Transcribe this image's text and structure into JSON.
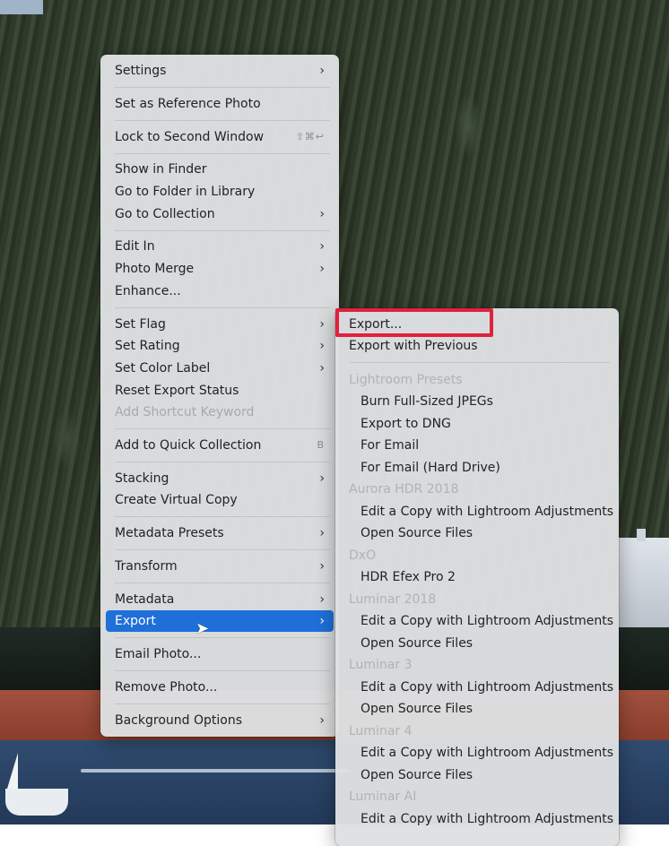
{
  "main_menu": {
    "items": [
      {
        "label": "Settings",
        "arrow": "›"
      },
      {
        "label": "Set as Reference Photo"
      },
      {
        "label": "Lock to Second Window",
        "shortcut": "⇧⌘↩"
      },
      {
        "label": "Show in Finder"
      },
      {
        "label": "Go to Folder in Library"
      },
      {
        "label": "Go to Collection",
        "arrow": "›"
      },
      {
        "label": "Edit In",
        "arrow": "›"
      },
      {
        "label": "Photo Merge",
        "arrow": "›"
      },
      {
        "label": "Enhance..."
      },
      {
        "label": "Set Flag",
        "arrow": "›"
      },
      {
        "label": "Set Rating",
        "arrow": "›"
      },
      {
        "label": "Set Color Label",
        "arrow": "›"
      },
      {
        "label": "Reset Export Status"
      },
      {
        "label": "Add Shortcut Keyword",
        "disabled": true
      },
      {
        "label": "Add to Quick Collection",
        "shortcut": "B"
      },
      {
        "label": "Stacking",
        "arrow": "›"
      },
      {
        "label": "Create Virtual Copy"
      },
      {
        "label": "Metadata Presets",
        "arrow": "›"
      },
      {
        "label": "Transform",
        "arrow": "›"
      },
      {
        "label": "Metadata",
        "arrow": "›"
      },
      {
        "label": "Export",
        "arrow": "›",
        "highlighted": true
      },
      {
        "label": "Email Photo..."
      },
      {
        "label": "Remove Photo..."
      },
      {
        "label": "Background Options",
        "arrow": "›"
      }
    ]
  },
  "export_menu": {
    "items": [
      {
        "label": "Export..."
      },
      {
        "label": "Export with Previous"
      },
      {
        "label": "Lightroom Presets",
        "heading": true
      },
      {
        "label": "Burn Full-Sized JPEGs"
      },
      {
        "label": "Export to DNG"
      },
      {
        "label": "For Email"
      },
      {
        "label": "For Email (Hard Drive)"
      },
      {
        "label": "Aurora HDR 2018",
        "heading": true
      },
      {
        "label": "Edit a Copy with Lightroom Adjustments"
      },
      {
        "label": "Open Source Files"
      },
      {
        "label": "DxO",
        "heading": true
      },
      {
        "label": "HDR Efex Pro 2"
      },
      {
        "label": "Luminar 2018",
        "heading": true
      },
      {
        "label": "Edit a Copy with Lightroom Adjustments"
      },
      {
        "label": "Open Source Files"
      },
      {
        "label": "Luminar 3",
        "heading": true
      },
      {
        "label": "Edit a Copy with Lightroom Adjustments"
      },
      {
        "label": "Open Source Files"
      },
      {
        "label": "Luminar 4",
        "heading": true
      },
      {
        "label": "Edit a Copy with Lightroom Adjustments"
      },
      {
        "label": "Open Source Files"
      },
      {
        "label": "Luminar AI",
        "heading": true
      },
      {
        "label": "Edit a Copy with Lightroom Adjustments"
      }
    ]
  },
  "colors": {
    "highlight": "#1f6fd8",
    "callout": "#e0213d"
  }
}
